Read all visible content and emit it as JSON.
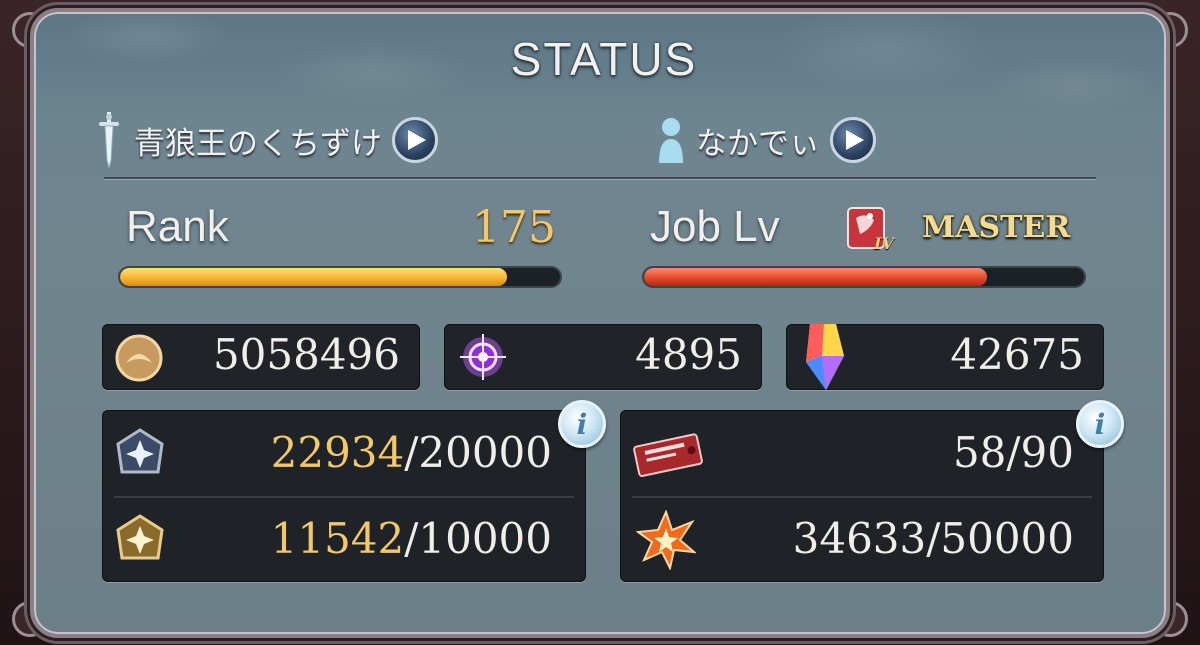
{
  "title": "STATUS",
  "weapon": {
    "name": "青狼王のくちずけ",
    "icon": "sword-icon"
  },
  "player": {
    "name": "なかでぃ",
    "icon": "person-icon"
  },
  "rank": {
    "label": "Rank",
    "value": "175",
    "progress": 0.88
  },
  "job": {
    "label": "Job Lv",
    "class_badge": "IV",
    "level_text": "MASTER",
    "progress": 0.78
  },
  "currencies": [
    {
      "icon": "rupie-coin-icon",
      "value": "5058496"
    },
    {
      "icon": "crystal-sparkle-icon",
      "value": "4895"
    },
    {
      "icon": "rainbow-crystal-icon",
      "value": "42675"
    }
  ],
  "stamina_left": {
    "info": "i",
    "rows": [
      {
        "icon": "ap-gem-icon",
        "current": "22934",
        "max": "/20000"
      },
      {
        "icon": "bp-gem-icon",
        "current": "11542",
        "max": "/10000"
      }
    ]
  },
  "stamina_right": {
    "info": "i",
    "rows": [
      {
        "icon": "ticket-icon",
        "value": "58/90"
      },
      {
        "icon": "burst-star-icon",
        "value": "34633/50000"
      }
    ]
  },
  "colors": {
    "accent_gold": "#f2c869",
    "rank_bar": "#f7b531",
    "job_bar": "#e24a2c"
  }
}
